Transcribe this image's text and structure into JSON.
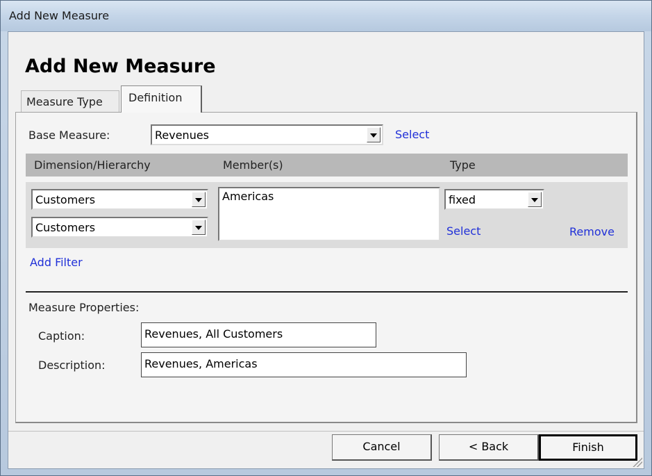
{
  "window": {
    "title": "Add New Measure"
  },
  "dialog": {
    "heading": "Add New Measure"
  },
  "tabs": [
    {
      "label": "Measure Type",
      "active": false
    },
    {
      "label": "Definition",
      "active": true
    }
  ],
  "base_measure": {
    "label": "Base Measure:",
    "value": "Revenues",
    "select_link": "Select"
  },
  "filter_table": {
    "headers": [
      "Dimension/Hierarchy",
      "Member(s)",
      "Type"
    ],
    "dimension_value": "Customers",
    "hierarchy_value": "Customers",
    "members_value": "Americas",
    "type_value": "fixed",
    "select_link": "Select",
    "remove_link": "Remove"
  },
  "add_filter_link": "Add Filter",
  "measure_properties": {
    "section_label": "Measure Properties:",
    "caption_label": "Caption:",
    "caption_value": "Revenues, All Customers",
    "description_label": "Description:",
    "description_value": "Revenues, Americas"
  },
  "buttons": {
    "cancel": "Cancel",
    "back": "< Back",
    "finish": "Finish"
  }
}
